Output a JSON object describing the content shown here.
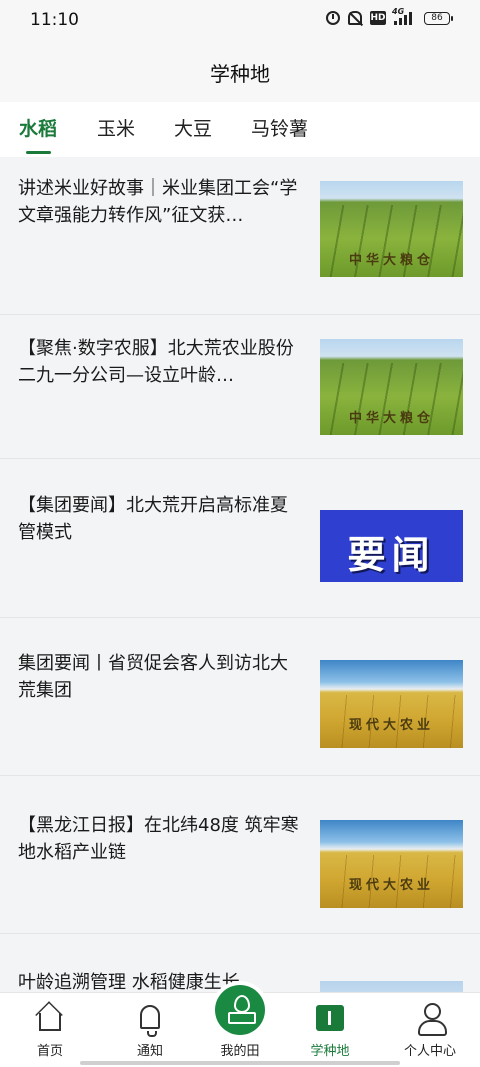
{
  "status_bar": {
    "time": "11:10",
    "hd": "HD",
    "network": "4G",
    "battery": "86",
    "icons": [
      "alarm-icon",
      "bell-off-icon",
      "hd-icon",
      "signal-icon",
      "battery-icon"
    ]
  },
  "header": {
    "title": "学种地"
  },
  "tabs": [
    {
      "label": "水稻",
      "active": true
    },
    {
      "label": "玉米",
      "active": false
    },
    {
      "label": "大豆",
      "active": false
    },
    {
      "label": "马铃薯",
      "active": false
    }
  ],
  "colors": {
    "accent": "#1a7a3a",
    "nav_center": "#1a8a42",
    "news_thumb": "#2f3fd0"
  },
  "articles": [
    {
      "title": "讲述米业好故事｜米业集团工会“学文章强能力转作风”征文获…",
      "thumb_caption": "中华大粮仓",
      "thumb": "green-field"
    },
    {
      "title": "【聚焦·数字农服】北大荒农业股份二九一分公司—设立叶龄…",
      "thumb_caption": "中华大粮仓",
      "thumb": "green-field"
    },
    {
      "title": "【集团要闻】北大荒开启高标准夏管模式",
      "thumb_caption": "要闻",
      "thumb": "news"
    },
    {
      "title": "集团要闻丨省贸促会客人到访北大荒集团",
      "thumb_caption": "现代大农业",
      "thumb": "gold-field"
    },
    {
      "title": "【黑龙江日报】在北纬48度 筑牢寒地水稻产业链",
      "thumb_caption": "现代大农业",
      "thumb": "gold-field"
    },
    {
      "title": "叶龄追溯管理 水稻健康生长",
      "thumb_caption": "",
      "thumb": "sky"
    }
  ],
  "bottom_nav": [
    {
      "label": "首页",
      "icon": "home-icon",
      "active": false
    },
    {
      "label": "通知",
      "icon": "bell-icon",
      "active": false
    },
    {
      "label": "我的田",
      "icon": "leaf-icon",
      "active": false
    },
    {
      "label": "学种地",
      "icon": "book-icon",
      "active": true
    },
    {
      "label": "个人中心",
      "icon": "person-icon",
      "active": false
    }
  ]
}
